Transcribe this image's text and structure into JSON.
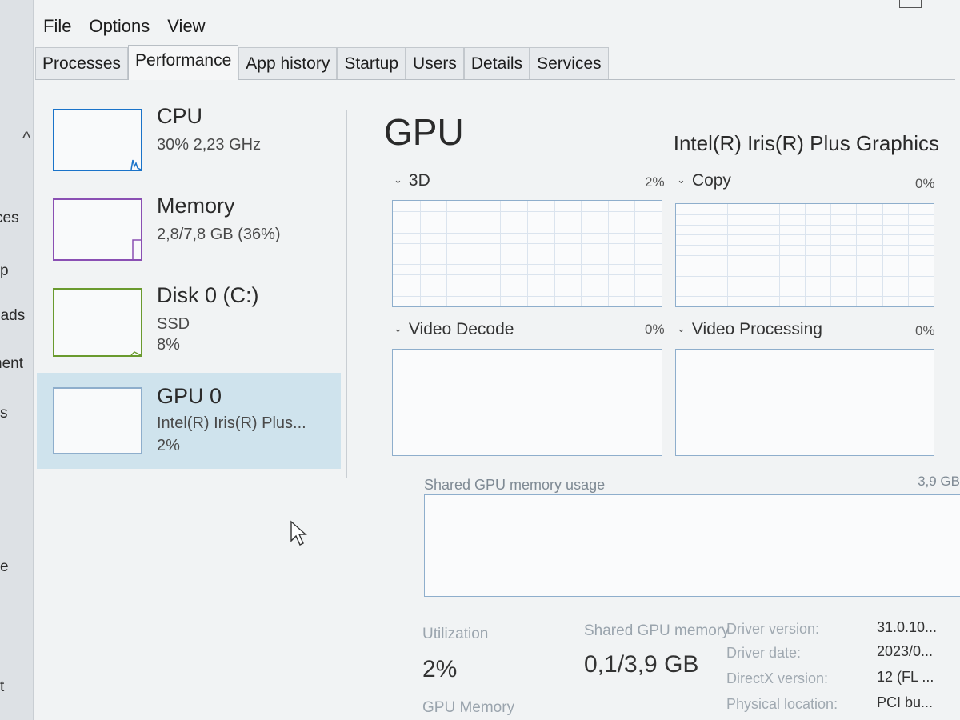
{
  "left_edge": {
    "fragments": [
      "ces",
      "p",
      "pads",
      "nent",
      "s",
      "e",
      "t"
    ]
  },
  "menu": [
    "File",
    "Options",
    "View"
  ],
  "tabs": [
    {
      "label": "Processes",
      "active": false
    },
    {
      "label": "Performance",
      "active": true
    },
    {
      "label": "App history",
      "active": false
    },
    {
      "label": "Startup",
      "active": false
    },
    {
      "label": "Users",
      "active": false
    },
    {
      "label": "Details",
      "active": false
    },
    {
      "label": "Services",
      "active": false
    }
  ],
  "sidebar": {
    "items": [
      {
        "title": "CPU",
        "line1": "30% 2,23 GHz",
        "line2": "",
        "color": "#1a73c9"
      },
      {
        "title": "Memory",
        "line1": "2,8/7,8 GB (36%)",
        "line2": "",
        "color": "#8a4fb3"
      },
      {
        "title": "Disk 0 (C:)",
        "line1": "SSD",
        "line2": "8%",
        "color": "#6a9a2e"
      },
      {
        "title": "GPU 0",
        "line1": "Intel(R) Iris(R) Plus...",
        "line2": "2%",
        "color": "#8eaecc",
        "selected": true
      }
    ]
  },
  "main": {
    "title": "GPU",
    "model": "Intel(R) Iris(R) Plus Graphics",
    "graphs": [
      {
        "label": "3D",
        "value": "2%"
      },
      {
        "label": "Copy",
        "value": "0%"
      },
      {
        "label": "Video Decode",
        "value": "0%"
      },
      {
        "label": "Video Processing",
        "value": "0%"
      }
    ],
    "shared_label": "Shared GPU memory usage",
    "shared_max": "3,9 GB",
    "stats": {
      "utilization_label": "Utilization",
      "utilization_value": "2%",
      "shared_mem_label": "Shared GPU memory",
      "shared_mem_value": "0,1/3,9 GB",
      "gpu_memory_label": "GPU Memory"
    },
    "info": [
      {
        "label": "Driver version:",
        "value": "31.0.10..."
      },
      {
        "label": "Driver date:",
        "value": "2023/0..."
      },
      {
        "label": "DirectX version:",
        "value": "12 (FL ..."
      },
      {
        "label": "Physical location:",
        "value": "PCI bu..."
      }
    ]
  }
}
